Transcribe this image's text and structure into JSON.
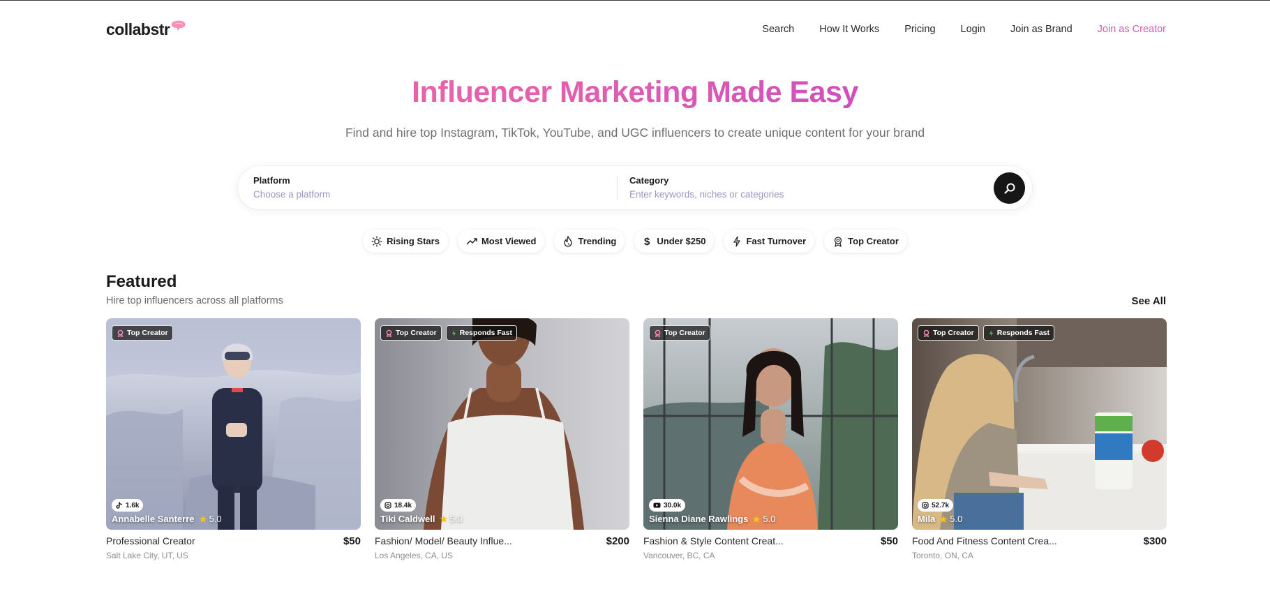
{
  "brand": {
    "name": "collabstr"
  },
  "nav": {
    "search": "Search",
    "how_it_works": "How It Works",
    "pricing": "Pricing",
    "login": "Login",
    "join_brand": "Join as Brand",
    "join_creator": "Join as Creator"
  },
  "hero": {
    "title": "Influencer Marketing Made Easy",
    "subtitle": "Find and hire top Instagram, TikTok, YouTube, and UGC influencers to create unique content for your brand"
  },
  "search": {
    "platform_label": "Platform",
    "platform_placeholder": "Choose a platform",
    "category_label": "Category",
    "category_placeholder": "Enter keywords, niches or categories"
  },
  "chips": [
    "Rising Stars",
    "Most Viewed",
    "Trending",
    "Under $250",
    "Fast Turnover",
    "Top Creator"
  ],
  "featured": {
    "title": "Featured",
    "subtitle": "Hire top influencers across all platforms",
    "see_all": "See All",
    "cards": [
      {
        "name": "Annabelle Santerre",
        "rating": "5.0",
        "platform_icon": "tiktok-icon",
        "followers": "1.6k",
        "badges": [
          "Top Creator"
        ],
        "title": "Professional Creator",
        "price": "$50",
        "location": "Salt Lake City, UT, US"
      },
      {
        "name": "Tiki Caldwell",
        "rating": "5.0",
        "platform_icon": "instagram-icon",
        "followers": "18.4k",
        "badges": [
          "Top Creator",
          "Responds Fast"
        ],
        "title": "Fashion/ Model/ Beauty Influe...",
        "price": "$200",
        "location": "Los Angeles, CA, US"
      },
      {
        "name": "Sienna Diane Rawlings",
        "rating": "5.0",
        "platform_icon": "youtube-icon",
        "followers": "30.0k",
        "badges": [
          "Top Creator"
        ],
        "title": "Fashion & Style Content Creat...",
        "price": "$50",
        "location": "Vancouver, BC, CA"
      },
      {
        "name": "Mila",
        "rating": "5.0",
        "platform_icon": "instagram-icon",
        "followers": "52.7k",
        "badges": [
          "Top Creator",
          "Responds Fast"
        ],
        "title": "Food And Fitness Content Crea...",
        "price": "$300",
        "location": "Toronto, ON, CA"
      }
    ]
  },
  "colors": {
    "accent_pink": "#f56d9b",
    "accent_purple": "#b23ad0",
    "creator_link": "#d65bb0",
    "bolt_green": "#3ccf6e",
    "star": "#f5c518"
  }
}
